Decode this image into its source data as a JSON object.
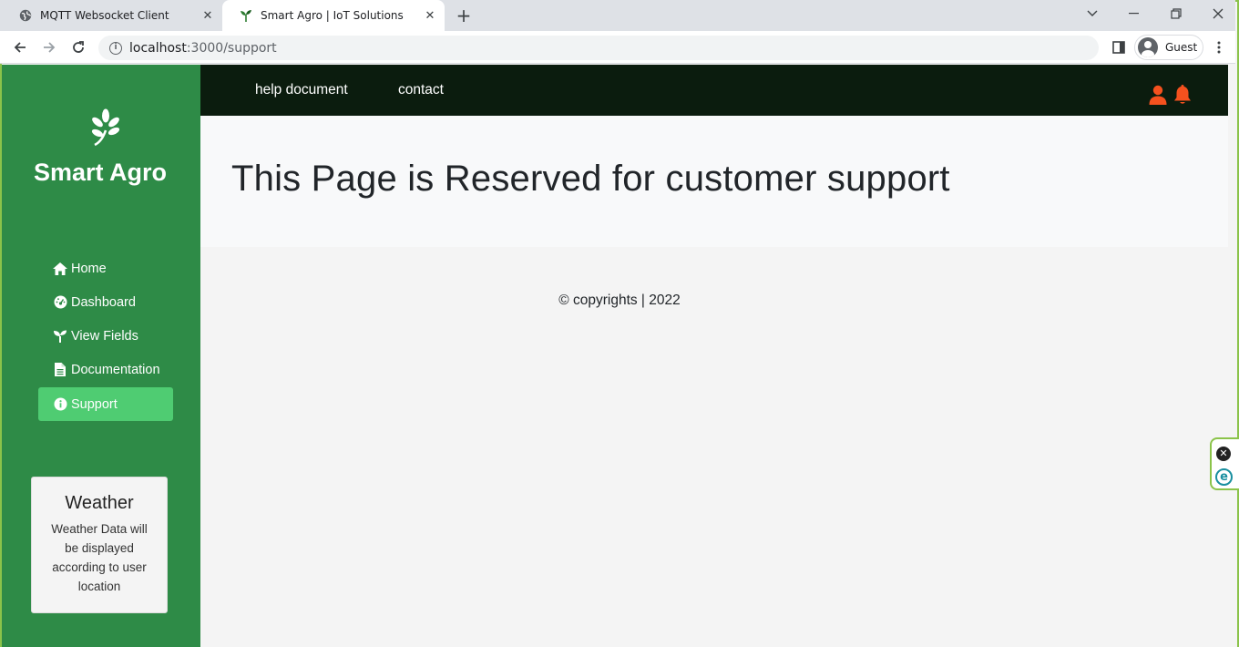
{
  "browser": {
    "tabs": [
      {
        "title": "MQTT Websocket Client",
        "icon": "globe-icon",
        "active": false
      },
      {
        "title": "Smart Agro | IoT Solutions",
        "icon": "sprout-icon",
        "active": true
      }
    ],
    "url_host": "localhost",
    "url_path": ":3000/support",
    "profile_label": "Guest"
  },
  "sidebar": {
    "brand": "Smart Agro",
    "items": [
      {
        "label": "Home",
        "icon": "home-icon"
      },
      {
        "label": "Dashboard",
        "icon": "dashboard-icon"
      },
      {
        "label": "View Fields",
        "icon": "seedling-icon"
      },
      {
        "label": "Documentation",
        "icon": "file-icon"
      },
      {
        "label": "Support",
        "icon": "info-icon",
        "active": true
      }
    ],
    "weather": {
      "title": "Weather",
      "text": "Weather Data will be displayed according to user location"
    }
  },
  "topnav": {
    "links": [
      "help document",
      "contact"
    ]
  },
  "main": {
    "heading": "This Page is Reserved for customer support",
    "footer": "© copyrights | 2022"
  },
  "colors": {
    "sidebar": "#2e8b47",
    "active_item": "#4fcc72",
    "topnav": "#0b1c0e",
    "accent_icons": "#f4511e"
  }
}
